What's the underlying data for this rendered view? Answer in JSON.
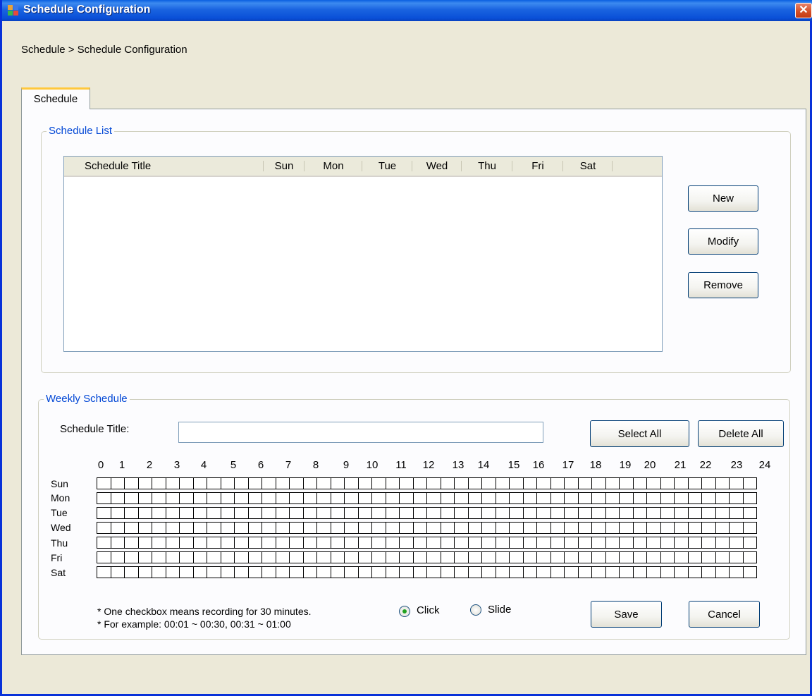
{
  "window": {
    "title": "Schedule Configuration",
    "close_glyph": "✕"
  },
  "breadcrumb": "Schedule > Schedule Configuration",
  "tab": {
    "label": "Schedule"
  },
  "schedule_list": {
    "legend": "Schedule List",
    "columns": [
      "Schedule Title",
      "Sun",
      "Mon",
      "Tue",
      "Wed",
      "Thu",
      "Fri",
      "Sat"
    ],
    "rows": [],
    "buttons": {
      "new": "New",
      "modify": "Modify",
      "remove": "Remove"
    }
  },
  "weekly_schedule": {
    "legend": "Weekly Schedule",
    "title_label": "Schedule Title:",
    "title_value": "",
    "select_all": "Select All",
    "delete_all": "Delete All",
    "hours": [
      "0",
      "1",
      "2",
      "3",
      "4",
      "5",
      "6",
      "7",
      "8",
      "9",
      "10",
      "11",
      "12",
      "13",
      "14",
      "15",
      "16",
      "17",
      "18",
      "19",
      "20",
      "21",
      "22",
      "23",
      "24"
    ],
    "days": [
      "Sun",
      "Mon",
      "Tue",
      "Wed",
      "Thu",
      "Fri",
      "Sat"
    ],
    "slots_per_day": 48,
    "checked_slots": [],
    "note_line1": "* One checkbox means recording for 30 minutes.",
    "note_line2": "* For example: 00:01 ~ 00:30, 00:31 ~ 01:00",
    "mode_options": [
      "Click",
      "Slide"
    ],
    "mode_selected": "Click",
    "save": "Save",
    "cancel": "Cancel"
  },
  "icons": {
    "app": "app-window-icon",
    "close": "close-icon"
  },
  "colors": {
    "titlebar": "#0a50d8",
    "legend_text": "#0046d5",
    "window_bg": "#ece9d8",
    "tab_accent": "#ffc83c",
    "radio_dot": "#21a121"
  }
}
